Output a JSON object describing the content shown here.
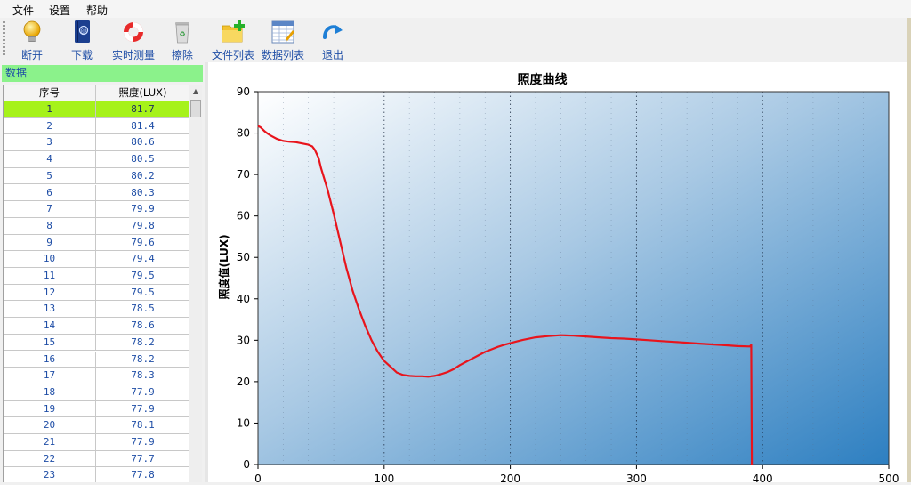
{
  "menu": [
    "文件",
    "设置",
    "帮助"
  ],
  "toolbar": {
    "buttons": [
      {
        "label": "断开",
        "icon": "lightbulb-icon"
      },
      {
        "label": "下载",
        "icon": "book-icon"
      },
      {
        "label": "实时测量",
        "icon": "lifebuoy-icon"
      },
      {
        "label": "擦除",
        "icon": "recycle-bin-icon"
      },
      {
        "label": "文件列表",
        "icon": "folder-add-icon"
      },
      {
        "label": "数据列表",
        "icon": "table-icon"
      },
      {
        "label": "退出",
        "icon": "exit-arrow-icon"
      }
    ]
  },
  "left_panel": {
    "title": "数据",
    "columns": [
      "序号",
      "照度(LUX)"
    ],
    "rows": [
      [
        "1",
        "81.7"
      ],
      [
        "2",
        "81.4"
      ],
      [
        "3",
        "80.6"
      ],
      [
        "4",
        "80.5"
      ],
      [
        "5",
        "80.2"
      ],
      [
        "6",
        "80.3"
      ],
      [
        "7",
        "79.9"
      ],
      [
        "8",
        "79.8"
      ],
      [
        "9",
        "79.6"
      ],
      [
        "10",
        "79.4"
      ],
      [
        "11",
        "79.5"
      ],
      [
        "12",
        "79.5"
      ],
      [
        "13",
        "78.5"
      ],
      [
        "14",
        "78.6"
      ],
      [
        "15",
        "78.2"
      ],
      [
        "16",
        "78.2"
      ],
      [
        "17",
        "78.3"
      ],
      [
        "18",
        "77.9"
      ],
      [
        "19",
        "77.9"
      ],
      [
        "20",
        "78.1"
      ],
      [
        "21",
        "77.9"
      ],
      [
        "22",
        "77.7"
      ],
      [
        "23",
        "77.8"
      ]
    ],
    "selected_row": 0,
    "selected_color": "#a6f21a"
  },
  "chart_data": {
    "type": "line",
    "title": "照度曲线",
    "ylabel": "照度值(LUX)",
    "xlabel": "",
    "xlim": [
      0,
      500
    ],
    "ylim": [
      0,
      90
    ],
    "xticks": [
      0,
      100,
      200,
      300,
      400,
      500
    ],
    "yticks": [
      0,
      10,
      20,
      30,
      40,
      50,
      60,
      70,
      80,
      90
    ],
    "grid": "vertical dotted",
    "line_color": "#e8141c",
    "background": "gradient white to blue",
    "series": [
      {
        "x": [
          0,
          2,
          5,
          8,
          10,
          15,
          20,
          25,
          30,
          35,
          40,
          43,
          45,
          48,
          50,
          55,
          60,
          65,
          70,
          75,
          80,
          85,
          90,
          95,
          100,
          105,
          110,
          115,
          120,
          125,
          130,
          135,
          140,
          145,
          150,
          155,
          160,
          165,
          170,
          175,
          180,
          185,
          190,
          195,
          200,
          205,
          210,
          220,
          230,
          240,
          250,
          260,
          270,
          280,
          290,
          300,
          310,
          320,
          330,
          340,
          350,
          360,
          370,
          380,
          390,
          391,
          391.5
        ],
        "y": [
          81.7,
          81.4,
          80.5,
          79.8,
          79.4,
          78.6,
          78.1,
          77.9,
          77.8,
          77.5,
          77.2,
          76.8,
          76,
          74,
          71.5,
          66.5,
          60.5,
          54,
          47.5,
          42,
          37.5,
          33.5,
          30,
          27.2,
          25,
          23.6,
          22.2,
          21.6,
          21.4,
          21.3,
          21.3,
          21.2,
          21.4,
          21.8,
          22.3,
          23,
          24,
          24.8,
          25.6,
          26.4,
          27.2,
          27.8,
          28.4,
          28.9,
          29.3,
          29.7,
          30.1,
          30.7,
          31,
          31.2,
          31.1,
          30.9,
          30.7,
          30.5,
          30.4,
          30.2,
          30,
          29.8,
          29.6,
          29.4,
          29.2,
          29,
          28.8,
          28.6,
          28.5,
          28.9,
          0
        ]
      }
    ]
  }
}
